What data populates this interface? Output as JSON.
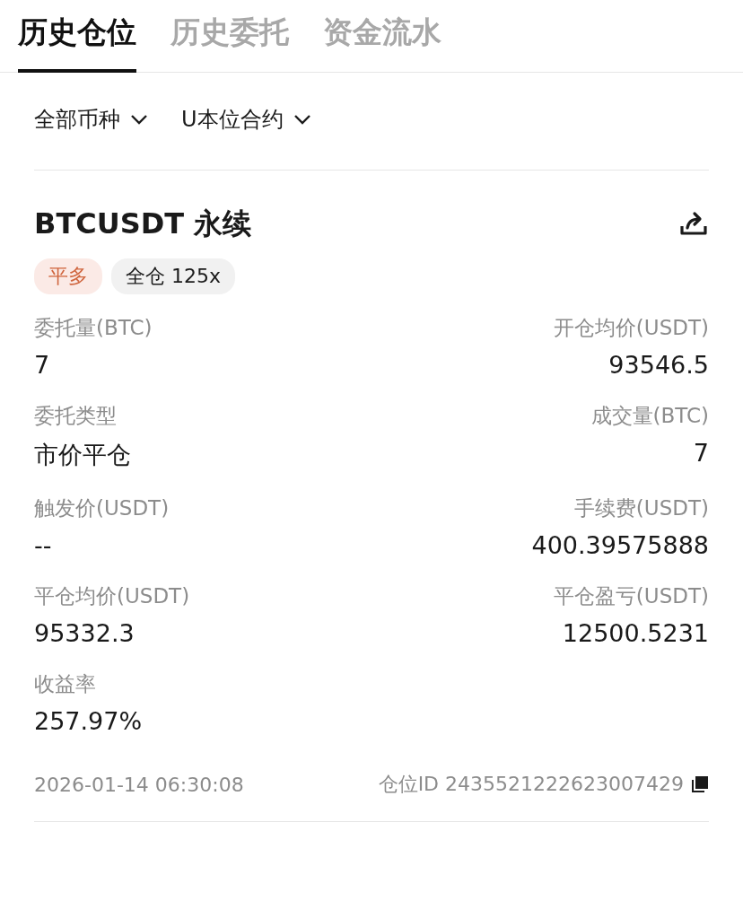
{
  "tabs": [
    {
      "label": "历史仓位",
      "selected": true
    },
    {
      "label": "历史委托",
      "selected": false
    },
    {
      "label": "资金流水",
      "selected": false
    }
  ],
  "filters": [
    {
      "label": "全部币种"
    },
    {
      "label": "U本位合约"
    }
  ],
  "position": {
    "title": "BTCUSDT 永续",
    "tags": [
      {
        "kind": "side",
        "label": "平多"
      },
      {
        "kind": "margin",
        "label": "全仓 125x"
      }
    ],
    "rows": [
      {
        "left": {
          "label": "委托量(BTC)",
          "value": "7"
        },
        "right": {
          "label": "开仓均价(USDT)",
          "value": "93546.5"
        }
      },
      {
        "left": {
          "label": "委托类型",
          "value": "市价平仓"
        },
        "right": {
          "label": "成交量(BTC)",
          "value": "7"
        }
      },
      {
        "left": {
          "label": "触发价(USDT)",
          "value": "--"
        },
        "right": {
          "label": "手续费(USDT)",
          "value": "400.39575888"
        }
      },
      {
        "left": {
          "label": "平仓均价(USDT)",
          "value": "95332.3"
        },
        "right": {
          "label": "平仓盈亏(USDT)",
          "value": "12500.5231"
        }
      },
      {
        "left": {
          "label": "收益率",
          "value": "257.97%"
        }
      }
    ],
    "time": "2026-01-14 06:30:08",
    "position_id": "仓位ID 2435521222623007429"
  }
}
